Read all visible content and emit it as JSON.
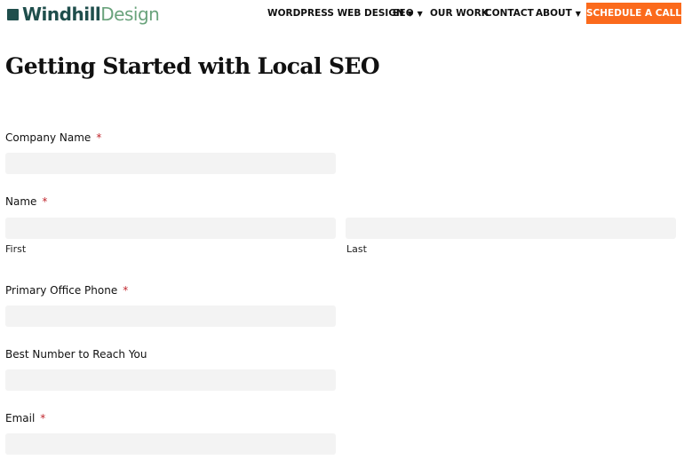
{
  "header": {
    "logo": {
      "part1": "Windhill",
      "part2": "Design"
    },
    "nav": [
      {
        "label": "WORDPRESS WEB DESIGN",
        "dropdown": true
      },
      {
        "label": "SEO",
        "dropdown": true
      },
      {
        "label": "OUR WORK",
        "dropdown": false
      },
      {
        "label": "CONTACT",
        "dropdown": false
      },
      {
        "label": "ABOUT",
        "dropdown": true
      }
    ],
    "cta": "SCHEDULE A CALL",
    "cta_color": "#fb6a1c"
  },
  "page": {
    "title": "Getting Started with Local SEO"
  },
  "form": {
    "required_marker": "*",
    "company": {
      "label": "Company Name",
      "value": ""
    },
    "name": {
      "label": "Name",
      "first_sub": "First",
      "last_sub": "Last",
      "first": "",
      "last": ""
    },
    "phone": {
      "label": "Primary Office Phone",
      "value": ""
    },
    "best": {
      "label": "Best Number to Reach You",
      "value": ""
    },
    "email": {
      "label": "Email",
      "value": ""
    }
  }
}
